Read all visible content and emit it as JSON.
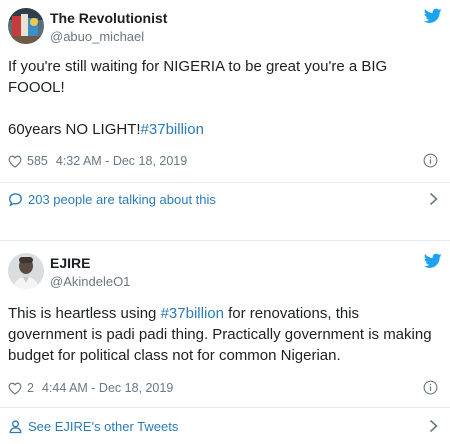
{
  "tweets": [
    {
      "display_name": "The Revolutionist",
      "handle": "@abuo_michael",
      "text_line1": "If you're still waiting for NIGERIA to be great you're a BIG FOOOL!",
      "text_line2_prefix": "60years NO LIGHT!",
      "hashtag": "#37billion",
      "likes": "585",
      "timestamp": "4:32 AM - Dec 18, 2019",
      "action_label": "203 people are talking about this",
      "avatar_icon": "avatar-graffiti-icon"
    },
    {
      "display_name": "EJIRE",
      "handle": "@AkindeleO1",
      "text_prefix": "This is heartless using ",
      "hashtag": "#37billion",
      "text_suffix": " for renovations, this government is padi padi thing. Practically government is making budget for political class not for common Nigerian.",
      "likes": "2",
      "timestamp": "4:44 AM - Dec 18, 2019",
      "action_label": "See EJIRE's other Tweets",
      "avatar_icon": "avatar-person-icon"
    }
  ],
  "colors": {
    "link_blue": "#2b7bb9",
    "twitter_blue": "#1da1f2",
    "meta_gray": "#697882",
    "text_dark": "#1c2022",
    "border": "#e6ecf0"
  }
}
